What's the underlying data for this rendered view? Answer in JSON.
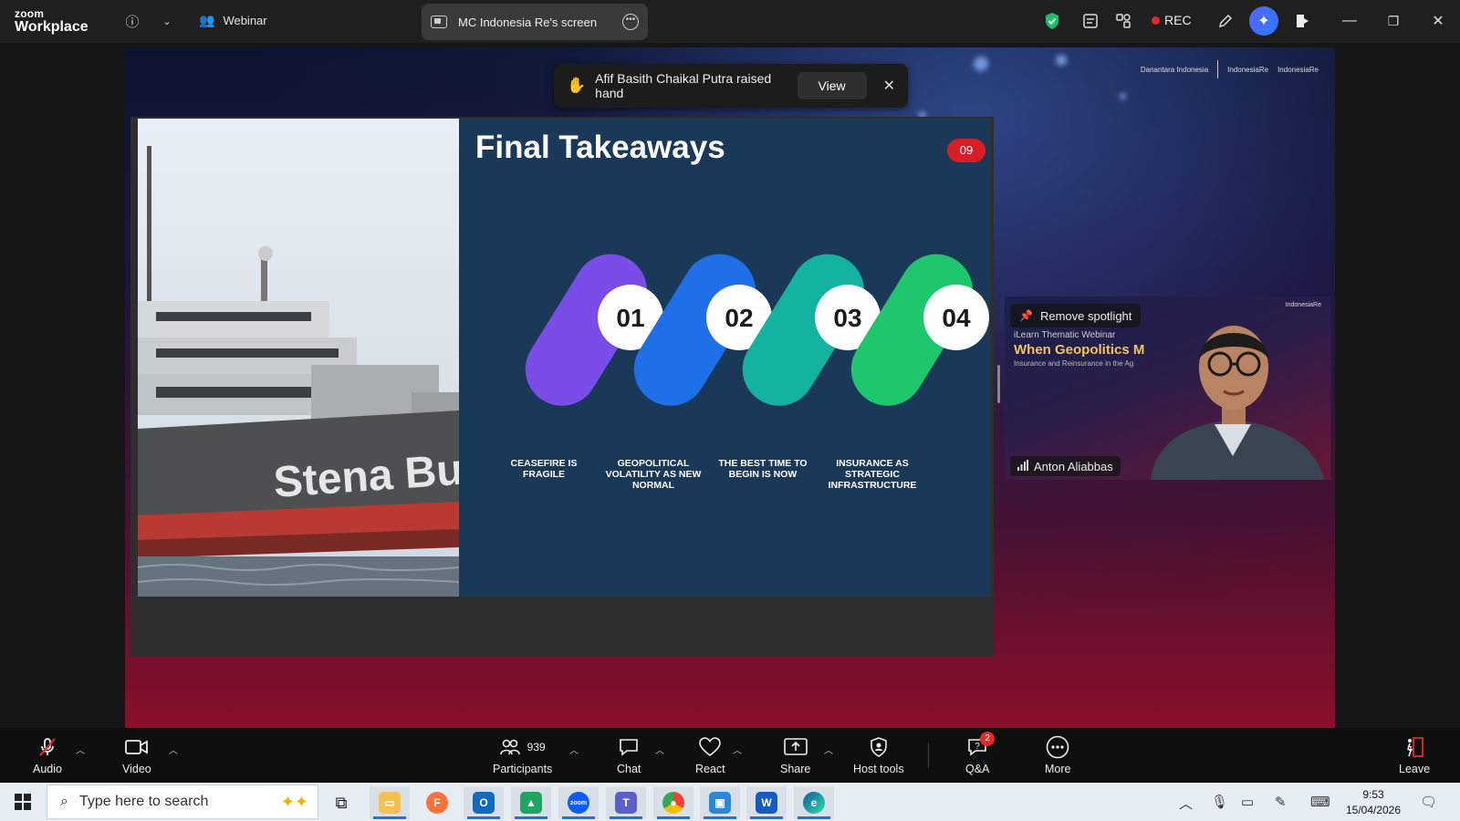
{
  "titlebar": {
    "brand_small": "zoom",
    "brand_large": "Workplace",
    "webinar_label": "Webinar",
    "screen_tab_label": "MC Indonesia Re's screen",
    "rec_label": "REC"
  },
  "share": {
    "logos": [
      "Danantara Indonesia",
      "IndonesiaRe",
      "IndonesiaRe"
    ]
  },
  "slide": {
    "title": "Final Takeaways",
    "page_number": "09",
    "steps": [
      {
        "number": "01",
        "label": "CEASEFIRE IS FRAGILE",
        "color": "#7a4de8"
      },
      {
        "number": "02",
        "label": "GEOPOLITICAL VOLATILITY AS NEW NORMAL",
        "color": "#1f6fe8"
      },
      {
        "number": "03",
        "label": "THE BEST TIME TO BEGIN IS NOW",
        "color": "#14b2a0"
      },
      {
        "number": "04",
        "label": "INSURANCE AS STRATEGIC INFRASTRUCTURE",
        "color": "#1ec66c"
      }
    ],
    "ship_hull_text": "Stena Bul"
  },
  "toast": {
    "message": "Afif Basith Chaikal Putra raised hand",
    "view_label": "View"
  },
  "video": {
    "spotlight_label": "Remove spotlight",
    "line1": "iLearn Thematic Webinar",
    "line2": "When Geopolitics M",
    "line3": "Insurance and Reinsurance in the Ag",
    "participant_name": "Anton Aliabbas"
  },
  "toolbar": {
    "audio": "Audio",
    "video": "Video",
    "participants": "Participants",
    "participants_count": "939",
    "chat": "Chat",
    "react": "React",
    "share": "Share",
    "host_tools": "Host tools",
    "qa": "Q&A",
    "qa_badge": "2",
    "more": "More",
    "leave": "Leave"
  },
  "taskbar": {
    "search_placeholder": "Type here to search",
    "time": "9:53",
    "date": "15/04/2026"
  }
}
